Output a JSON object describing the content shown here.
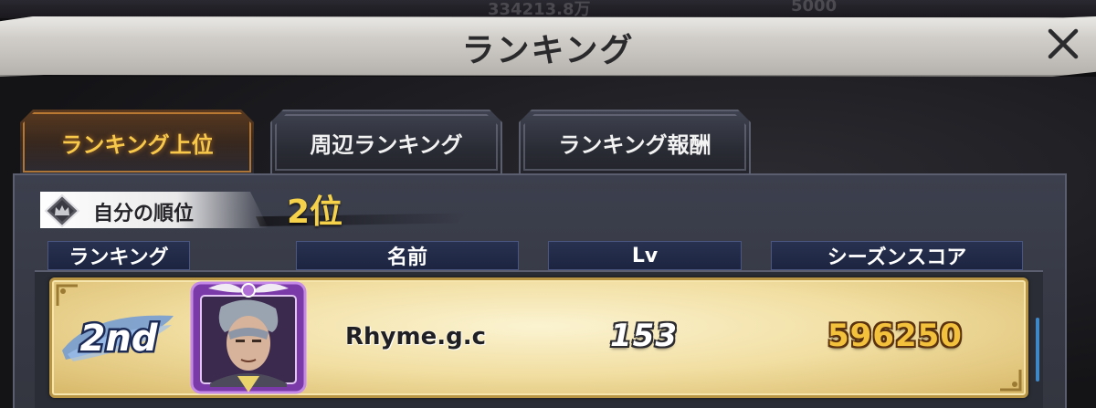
{
  "background": {
    "ghost_left": "334213.8万",
    "ghost_right": "5000"
  },
  "header": {
    "title": "ランキング",
    "close_icon": "close-icon"
  },
  "tabs": [
    {
      "label": "ランキング上位",
      "active": true
    },
    {
      "label": "周辺ランキング",
      "active": false
    },
    {
      "label": "ランキング報酬",
      "active": false
    }
  ],
  "my_rank": {
    "label": "自分の順位",
    "value": "2位",
    "icon": "crown-diamond-icon"
  },
  "columns": {
    "rank": "ランキング",
    "name": "名前",
    "level": "Lv",
    "score": "シーズンスコア"
  },
  "rows": [
    {
      "rank_badge": "2nd",
      "avatar_icon": "character-portrait-icon",
      "name": "Rhyme.g.c",
      "level": "153",
      "score": "596250"
    }
  ],
  "colors": {
    "accent_gold": "#f5d24a",
    "active_tab_text": "#f7c84a",
    "header_bg": "#283250",
    "scroll_thumb": "#3f88c7"
  }
}
